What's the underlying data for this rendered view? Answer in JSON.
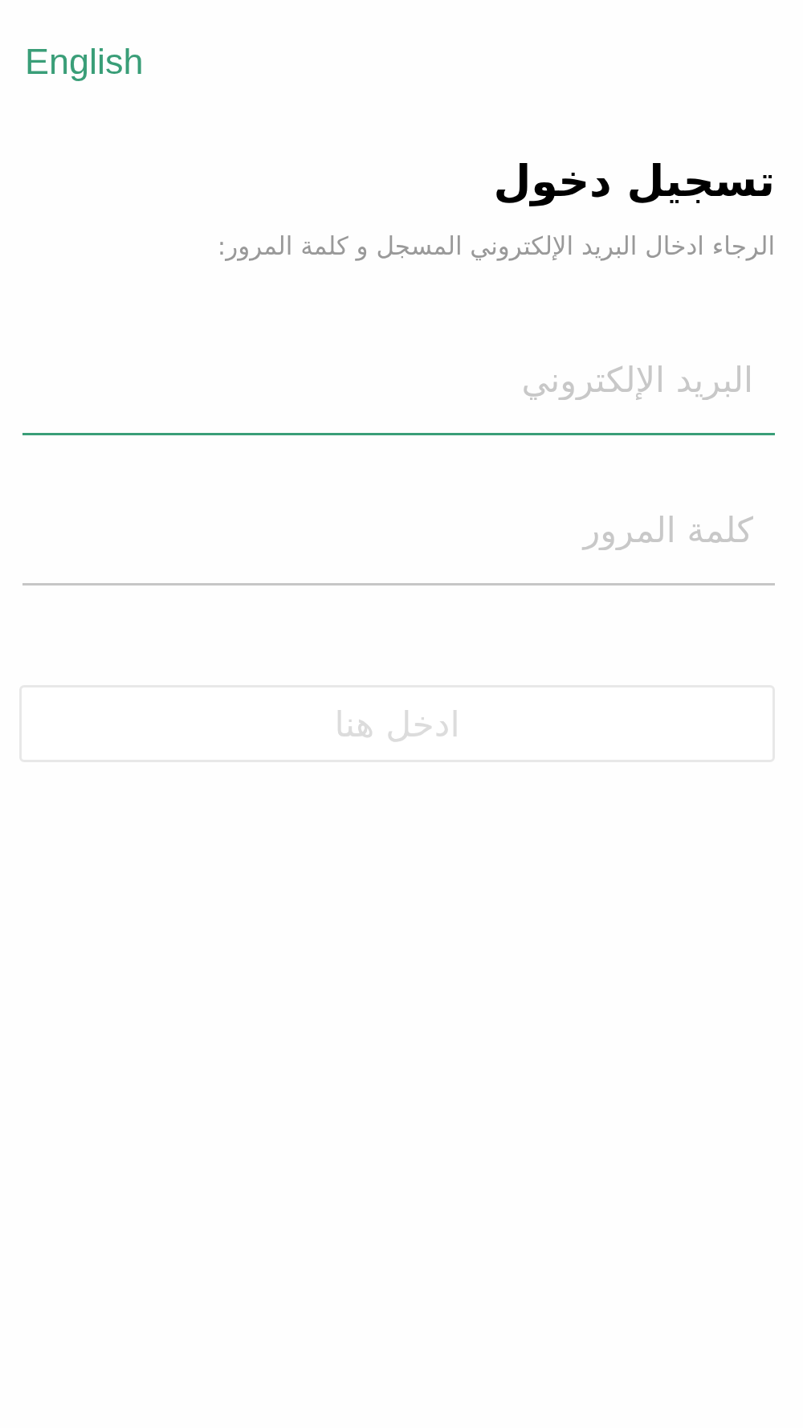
{
  "language_link": {
    "label": "English"
  },
  "header": {
    "title": "تسجيل دخول",
    "subtitle": "الرجاء ادخال البريد الإلكتروني المسجل و كلمة المرور:"
  },
  "email_field": {
    "placeholder": "البريد الإلكتروني",
    "focused": true
  },
  "password_field": {
    "placeholder": "كلمة المرور",
    "focused": false
  },
  "login_button": {
    "label": "ادخل هنا",
    "disabled": true
  }
}
